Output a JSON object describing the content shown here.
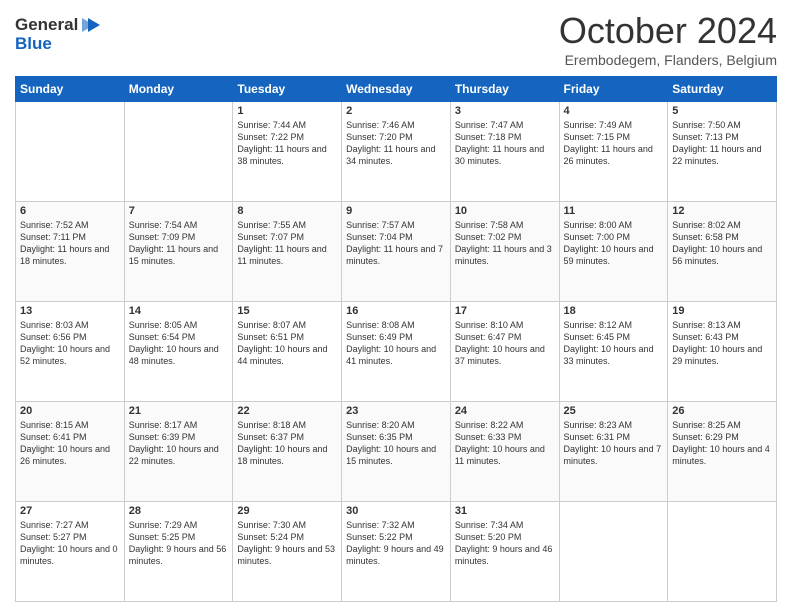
{
  "header": {
    "logo_general": "General",
    "logo_blue": "Blue",
    "month": "October 2024",
    "location": "Erembodegem, Flanders, Belgium"
  },
  "days_of_week": [
    "Sunday",
    "Monday",
    "Tuesday",
    "Wednesday",
    "Thursday",
    "Friday",
    "Saturday"
  ],
  "weeks": [
    [
      {
        "day": "",
        "sunrise": "",
        "sunset": "",
        "daylight": ""
      },
      {
        "day": "",
        "sunrise": "",
        "sunset": "",
        "daylight": ""
      },
      {
        "day": "1",
        "sunrise": "Sunrise: 7:44 AM",
        "sunset": "Sunset: 7:22 PM",
        "daylight": "Daylight: 11 hours and 38 minutes."
      },
      {
        "day": "2",
        "sunrise": "Sunrise: 7:46 AM",
        "sunset": "Sunset: 7:20 PM",
        "daylight": "Daylight: 11 hours and 34 minutes."
      },
      {
        "day": "3",
        "sunrise": "Sunrise: 7:47 AM",
        "sunset": "Sunset: 7:18 PM",
        "daylight": "Daylight: 11 hours and 30 minutes."
      },
      {
        "day": "4",
        "sunrise": "Sunrise: 7:49 AM",
        "sunset": "Sunset: 7:15 PM",
        "daylight": "Daylight: 11 hours and 26 minutes."
      },
      {
        "day": "5",
        "sunrise": "Sunrise: 7:50 AM",
        "sunset": "Sunset: 7:13 PM",
        "daylight": "Daylight: 11 hours and 22 minutes."
      }
    ],
    [
      {
        "day": "6",
        "sunrise": "Sunrise: 7:52 AM",
        "sunset": "Sunset: 7:11 PM",
        "daylight": "Daylight: 11 hours and 18 minutes."
      },
      {
        "day": "7",
        "sunrise": "Sunrise: 7:54 AM",
        "sunset": "Sunset: 7:09 PM",
        "daylight": "Daylight: 11 hours and 15 minutes."
      },
      {
        "day": "8",
        "sunrise": "Sunrise: 7:55 AM",
        "sunset": "Sunset: 7:07 PM",
        "daylight": "Daylight: 11 hours and 11 minutes."
      },
      {
        "day": "9",
        "sunrise": "Sunrise: 7:57 AM",
        "sunset": "Sunset: 7:04 PM",
        "daylight": "Daylight: 11 hours and 7 minutes."
      },
      {
        "day": "10",
        "sunrise": "Sunrise: 7:58 AM",
        "sunset": "Sunset: 7:02 PM",
        "daylight": "Daylight: 11 hours and 3 minutes."
      },
      {
        "day": "11",
        "sunrise": "Sunrise: 8:00 AM",
        "sunset": "Sunset: 7:00 PM",
        "daylight": "Daylight: 10 hours and 59 minutes."
      },
      {
        "day": "12",
        "sunrise": "Sunrise: 8:02 AM",
        "sunset": "Sunset: 6:58 PM",
        "daylight": "Daylight: 10 hours and 56 minutes."
      }
    ],
    [
      {
        "day": "13",
        "sunrise": "Sunrise: 8:03 AM",
        "sunset": "Sunset: 6:56 PM",
        "daylight": "Daylight: 10 hours and 52 minutes."
      },
      {
        "day": "14",
        "sunrise": "Sunrise: 8:05 AM",
        "sunset": "Sunset: 6:54 PM",
        "daylight": "Daylight: 10 hours and 48 minutes."
      },
      {
        "day": "15",
        "sunrise": "Sunrise: 8:07 AM",
        "sunset": "Sunset: 6:51 PM",
        "daylight": "Daylight: 10 hours and 44 minutes."
      },
      {
        "day": "16",
        "sunrise": "Sunrise: 8:08 AM",
        "sunset": "Sunset: 6:49 PM",
        "daylight": "Daylight: 10 hours and 41 minutes."
      },
      {
        "day": "17",
        "sunrise": "Sunrise: 8:10 AM",
        "sunset": "Sunset: 6:47 PM",
        "daylight": "Daylight: 10 hours and 37 minutes."
      },
      {
        "day": "18",
        "sunrise": "Sunrise: 8:12 AM",
        "sunset": "Sunset: 6:45 PM",
        "daylight": "Daylight: 10 hours and 33 minutes."
      },
      {
        "day": "19",
        "sunrise": "Sunrise: 8:13 AM",
        "sunset": "Sunset: 6:43 PM",
        "daylight": "Daylight: 10 hours and 29 minutes."
      }
    ],
    [
      {
        "day": "20",
        "sunrise": "Sunrise: 8:15 AM",
        "sunset": "Sunset: 6:41 PM",
        "daylight": "Daylight: 10 hours and 26 minutes."
      },
      {
        "day": "21",
        "sunrise": "Sunrise: 8:17 AM",
        "sunset": "Sunset: 6:39 PM",
        "daylight": "Daylight: 10 hours and 22 minutes."
      },
      {
        "day": "22",
        "sunrise": "Sunrise: 8:18 AM",
        "sunset": "Sunset: 6:37 PM",
        "daylight": "Daylight: 10 hours and 18 minutes."
      },
      {
        "day": "23",
        "sunrise": "Sunrise: 8:20 AM",
        "sunset": "Sunset: 6:35 PM",
        "daylight": "Daylight: 10 hours and 15 minutes."
      },
      {
        "day": "24",
        "sunrise": "Sunrise: 8:22 AM",
        "sunset": "Sunset: 6:33 PM",
        "daylight": "Daylight: 10 hours and 11 minutes."
      },
      {
        "day": "25",
        "sunrise": "Sunrise: 8:23 AM",
        "sunset": "Sunset: 6:31 PM",
        "daylight": "Daylight: 10 hours and 7 minutes."
      },
      {
        "day": "26",
        "sunrise": "Sunrise: 8:25 AM",
        "sunset": "Sunset: 6:29 PM",
        "daylight": "Daylight: 10 hours and 4 minutes."
      }
    ],
    [
      {
        "day": "27",
        "sunrise": "Sunrise: 7:27 AM",
        "sunset": "Sunset: 5:27 PM",
        "daylight": "Daylight: 10 hours and 0 minutes."
      },
      {
        "day": "28",
        "sunrise": "Sunrise: 7:29 AM",
        "sunset": "Sunset: 5:25 PM",
        "daylight": "Daylight: 9 hours and 56 minutes."
      },
      {
        "day": "29",
        "sunrise": "Sunrise: 7:30 AM",
        "sunset": "Sunset: 5:24 PM",
        "daylight": "Daylight: 9 hours and 53 minutes."
      },
      {
        "day": "30",
        "sunrise": "Sunrise: 7:32 AM",
        "sunset": "Sunset: 5:22 PM",
        "daylight": "Daylight: 9 hours and 49 minutes."
      },
      {
        "day": "31",
        "sunrise": "Sunrise: 7:34 AM",
        "sunset": "Sunset: 5:20 PM",
        "daylight": "Daylight: 9 hours and 46 minutes."
      },
      {
        "day": "",
        "sunrise": "",
        "sunset": "",
        "daylight": ""
      },
      {
        "day": "",
        "sunrise": "",
        "sunset": "",
        "daylight": ""
      }
    ]
  ]
}
